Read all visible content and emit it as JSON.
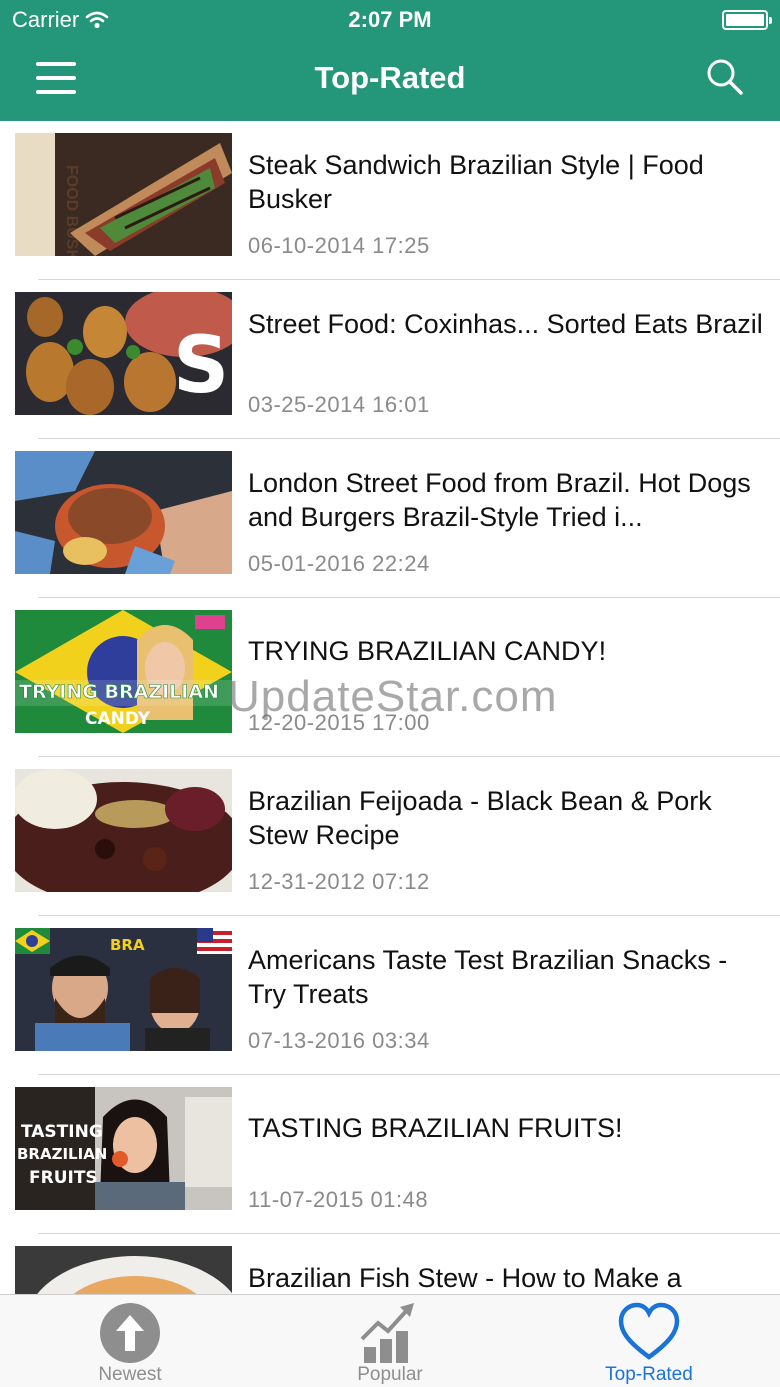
{
  "status_bar": {
    "carrier": "Carrier",
    "time": "2:07 PM"
  },
  "nav": {
    "title": "Top-Rated"
  },
  "colors": {
    "header": "#24977a",
    "active_tab": "#1a73d9",
    "date_text": "#8a8a8a"
  },
  "videos": [
    {
      "title": "Steak Sandwich Brazilian Style | Food Busker",
      "date": "06-10-2014 17:25"
    },
    {
      "title": "Street Food: Coxinhas... Sorted Eats Brazil",
      "date": "03-25-2014 16:01"
    },
    {
      "title": "London Street Food from Brazil. Hot Dogs and Burgers Brazil-Style Tried i...",
      "date": "05-01-2016 22:24"
    },
    {
      "title": "TRYING BRAZILIAN CANDY!",
      "date": "12-20-2015 17:00"
    },
    {
      "title": "Brazilian Feijoada - Black Bean & Pork Stew Recipe",
      "date": "12-31-2012 07:12"
    },
    {
      "title": "Americans Taste Test Brazilian Snacks - Try Treats",
      "date": "07-13-2016 03:34"
    },
    {
      "title": "TASTING BRAZILIAN FRUITS!",
      "date": "11-07-2015 01:48"
    },
    {
      "title": "Brazilian Fish Stew - How to Make a",
      "date": ""
    }
  ],
  "thumbnail_text": {
    "food_busker": "FOOD BUSKER",
    "sorted": "S",
    "candy_line1": "TRYING BRAZILIAN",
    "candy_line2": "CANDY",
    "snacks_banner": "BRA",
    "fruits": [
      "TASTING",
      "BRAZILIAN",
      "FRUITS"
    ]
  },
  "watermark": "UpdateStar.com",
  "tabs": [
    {
      "label": "Newest",
      "icon": "arrow-up-circle-icon",
      "active": false
    },
    {
      "label": "Popular",
      "icon": "bar-chart-trend-icon",
      "active": false
    },
    {
      "label": "Top-Rated",
      "icon": "heart-icon",
      "active": true
    }
  ]
}
